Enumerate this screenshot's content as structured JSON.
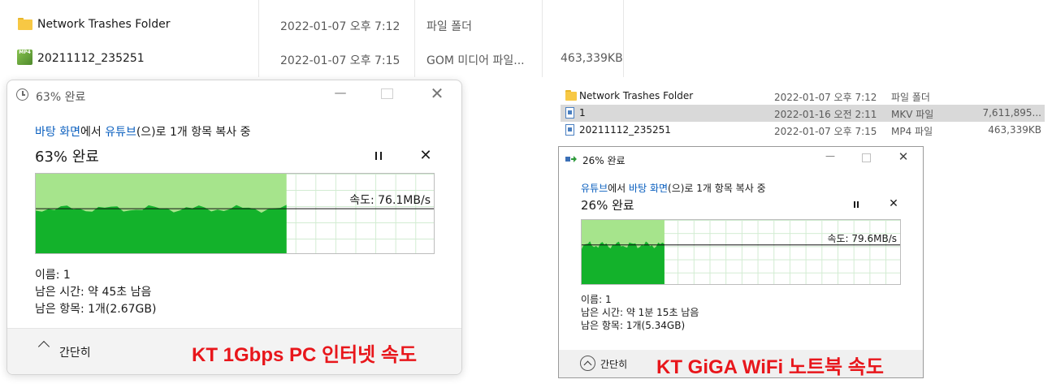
{
  "top_explorer": {
    "rows": [
      {
        "icon": "folder-icon",
        "name": "Network Trashes Folder",
        "date": "2022-01-07 오후 7:12",
        "type": "파일 폴더",
        "size": ""
      },
      {
        "icon": "mp4-icon",
        "name": "20211112_235251",
        "date": "2022-01-07 오후 7:15",
        "type": "GOM 미디어 파일...",
        "size": "463,339KB"
      }
    ]
  },
  "right_explorer": {
    "rows": [
      {
        "icon": "folder-icon",
        "name": "Network Trashes Folder",
        "date": "2022-01-07 오후 7:12",
        "type": "파일 폴더",
        "size": ""
      },
      {
        "icon": "file-icon",
        "name": "1",
        "date": "2022-01-16 오전 2:11",
        "type": "MKV 파일",
        "size": "7,611,895..."
      },
      {
        "icon": "file-icon",
        "name": "20211112_235251",
        "date": "2022-01-07 오후 7:15",
        "type": "MP4 파일",
        "size": "463,339KB"
      }
    ]
  },
  "left_dialog": {
    "title": "63% 완료",
    "from": "바탕 화면",
    "mid": "에서",
    "to": "유튜브",
    "tail": "(으)로 1개 항목 복사 중",
    "progress_text": "63% 완료",
    "progress_fraction": 0.63,
    "speed": "속도: 76.1MB/s",
    "name_line": "이름: 1",
    "time_line": "남은 시간: 약 45초 남음",
    "items_line": "남은 항목: 1개(2.67GB)",
    "less_details": "간단히",
    "caption": "KT 1Gbps PC 인터넷 속도",
    "icons": {
      "title": "clock-icon",
      "pause": "pause-icon",
      "cancel": "close-icon",
      "toggle": "chevron-up-icon"
    }
  },
  "right_dialog": {
    "title": "26% 완료",
    "from": "유튜브",
    "mid": "에서",
    "to": "바탕 화면",
    "tail": "(으)로 1개 항목 복사 중",
    "progress_text": "26% 완료",
    "progress_fraction": 0.26,
    "speed": "속도: 79.6MB/s",
    "name_line": "이름: 1",
    "time_line": "남은 시간: 약 1분 15초 남음",
    "items_line": "남은 항목: 1개(5.34GB)",
    "less_details": "간단히",
    "caption": "KT GiGA WiFi 노트북 속도",
    "icons": {
      "title": "copy-arrow-icon",
      "pause": "pause-icon",
      "cancel": "close-icon",
      "toggle": "chevron-up-circle-icon"
    }
  },
  "colors": {
    "graph_fill": "#13b22b",
    "graph_light": "#a6e48c",
    "caption": "#e8161b",
    "link": "#0a5fbf"
  }
}
